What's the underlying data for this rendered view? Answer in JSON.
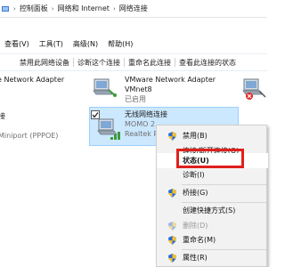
{
  "breadcrumb": {
    "items": [
      "控制面板",
      "网络和 Internet",
      "网络连接"
    ]
  },
  "menubar": {
    "items": [
      "查看(V)",
      "工具(T)",
      "高级(N)",
      "帮助(H)"
    ]
  },
  "command_bar": {
    "items": [
      "禁用此网络设备",
      "诊断这个连接",
      "重命名此连接",
      "查看此连接的状态"
    ]
  },
  "adapters": [
    {
      "name": "e Network Adapter",
      "line2": "",
      "line3": ""
    },
    {
      "name": "VMware Network Adapter",
      "line2": "VMnet8",
      "line3": "已启用"
    },
    {
      "name": "接",
      "line2": "",
      "line3": "Miniport (PPPOE)"
    },
    {
      "name": "无线网络连接",
      "line2": "MOMO 2",
      "line3": "Realtek RT"
    }
  ],
  "context_menu": {
    "items": [
      {
        "label": "禁用(B)",
        "shield": true,
        "disabled": false
      },
      {
        "label": "连接/断开连接(O)",
        "shield": false,
        "disabled": false
      },
      {
        "label": "状态(U)",
        "shield": false,
        "disabled": false,
        "highlighted": true
      },
      {
        "label": "诊断(I)",
        "shield": false,
        "disabled": false
      },
      {
        "label": "桥接(G)",
        "shield": true,
        "disabled": false
      },
      {
        "label": "创建快捷方式(S)",
        "shield": false,
        "disabled": false
      },
      {
        "label": "删除(D)",
        "shield": true,
        "disabled": true
      },
      {
        "label": "重命名(M)",
        "shield": true,
        "disabled": false
      },
      {
        "label": "属性(R)",
        "shield": true,
        "disabled": false
      }
    ]
  },
  "colors": {
    "highlight_box": "#e0201b",
    "selection_bg": "#cce8ff",
    "menu_bg": "#f2f2f2"
  },
  "icons": {
    "network": "network-adapter-icon",
    "shield": "uac-shield-icon",
    "folder": "control-panel-icon"
  }
}
